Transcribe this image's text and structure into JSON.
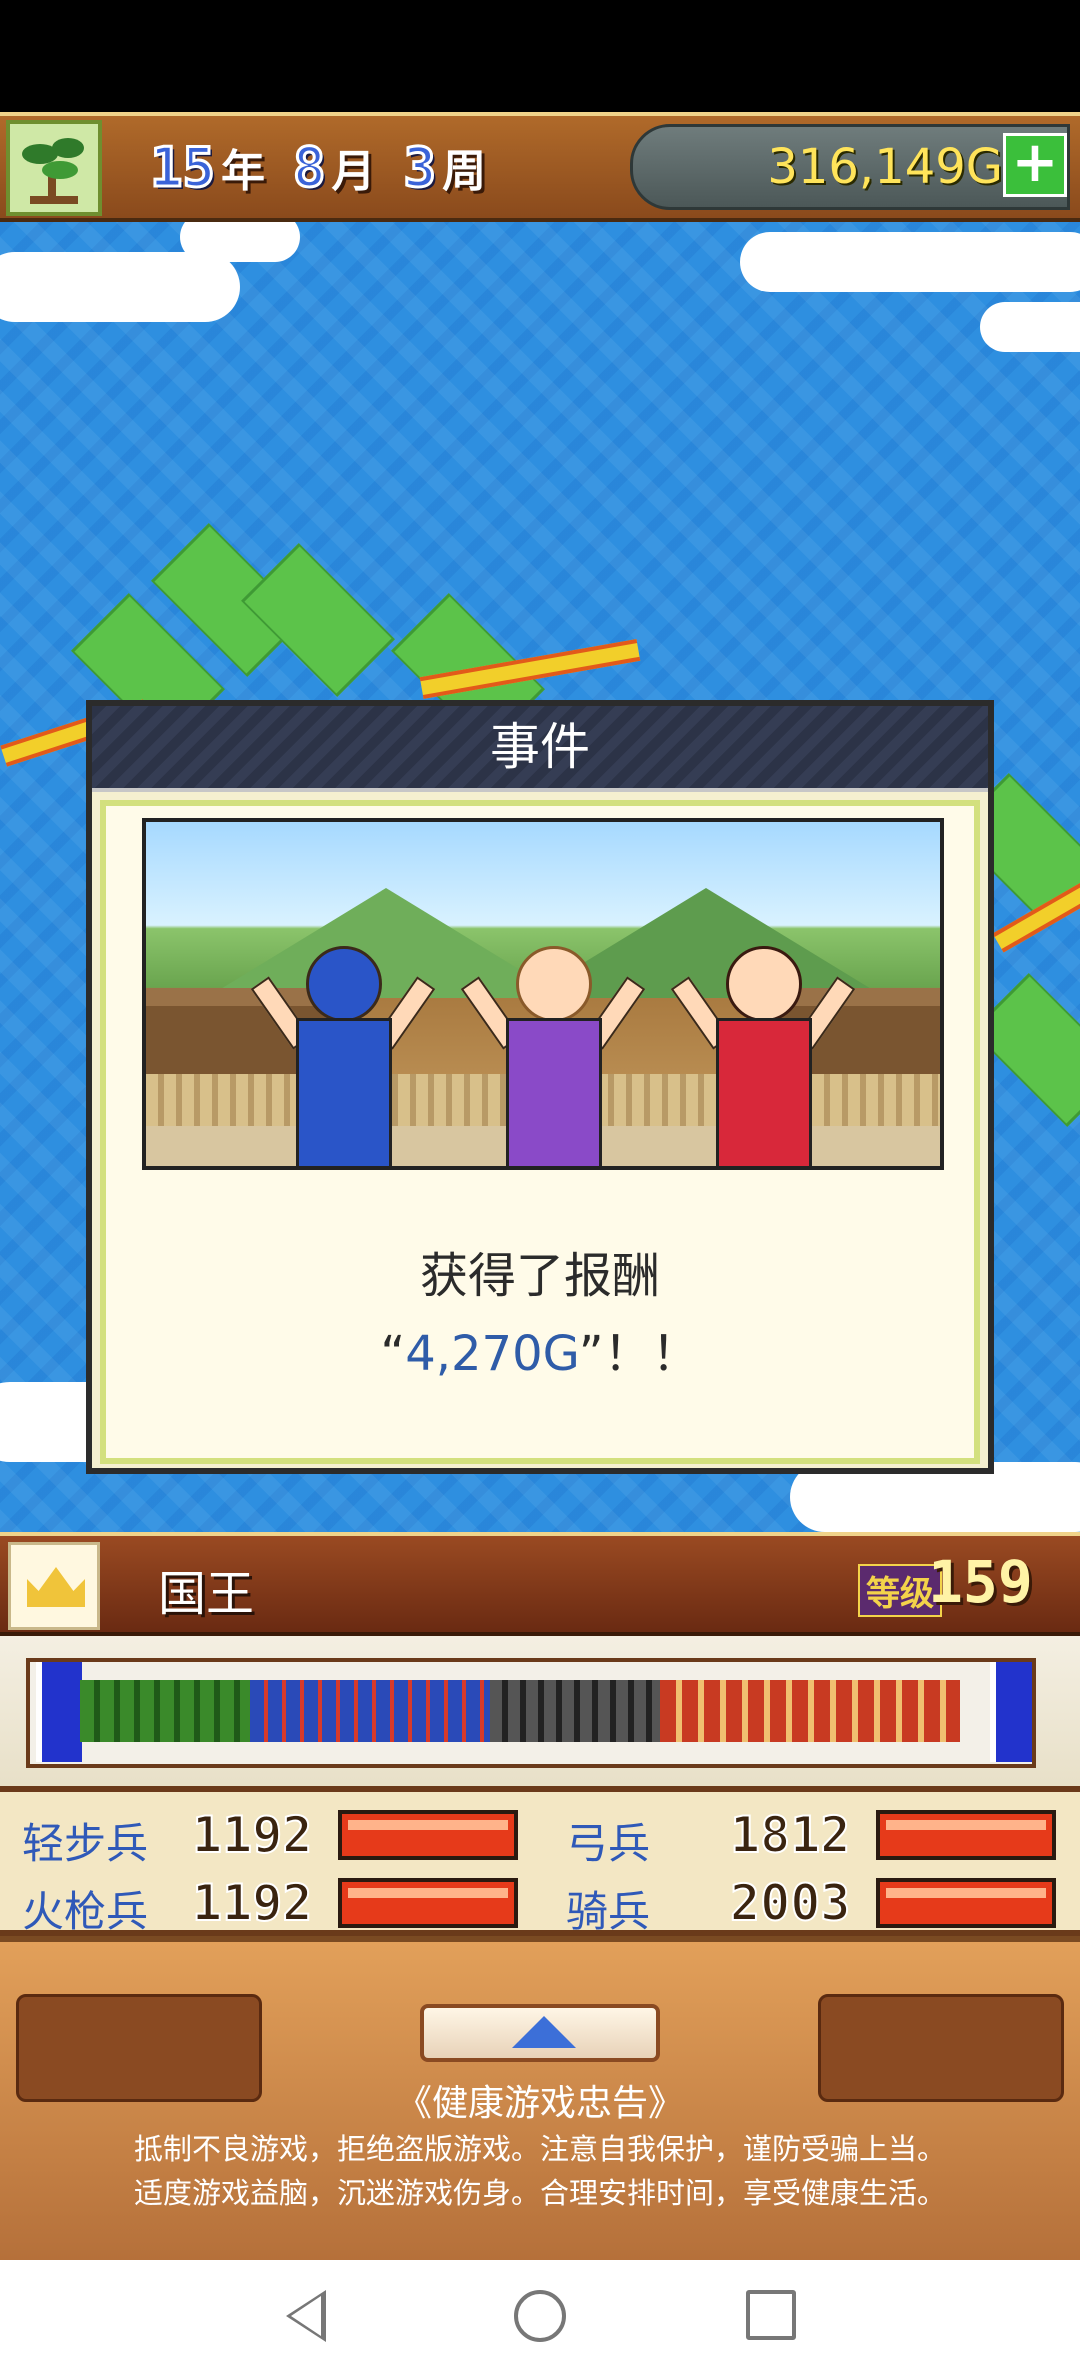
{
  "header": {
    "year_num": "15",
    "year_unit": "年",
    "month_num": "8",
    "month_unit": "月",
    "week_num": "3",
    "week_unit": "周",
    "money": "316,149G",
    "add_label": "+"
  },
  "event_dialog": {
    "title": "事件",
    "message_line1": "获得了报酬",
    "quote_open": "“",
    "amount": "4,270G",
    "quote_close": "”！！"
  },
  "king": {
    "name": "国王",
    "level_label": "等级",
    "level_value": "159"
  },
  "stats": [
    {
      "label": "轻步兵",
      "value": "1192"
    },
    {
      "label": "弓兵",
      "value": "1812"
    },
    {
      "label": "火枪兵",
      "value": "1192"
    },
    {
      "label": "骑兵",
      "value": "2003"
    }
  ],
  "notice": {
    "title": "《健康游戏忠告》",
    "line1": "抵制不良游戏，拒绝盗版游戏。注意自我保护，谨防受骗上当。",
    "line2": "适度游戏益脑，沉迷游戏伤身。合理安排时间，享受健康生活。"
  },
  "colors": {
    "sea": "#2e8fe0",
    "land": "#5cc34a",
    "accent_blue": "#3a63d8",
    "money_yellow": "#ffe45a",
    "bar_red": "#e63a1a"
  }
}
